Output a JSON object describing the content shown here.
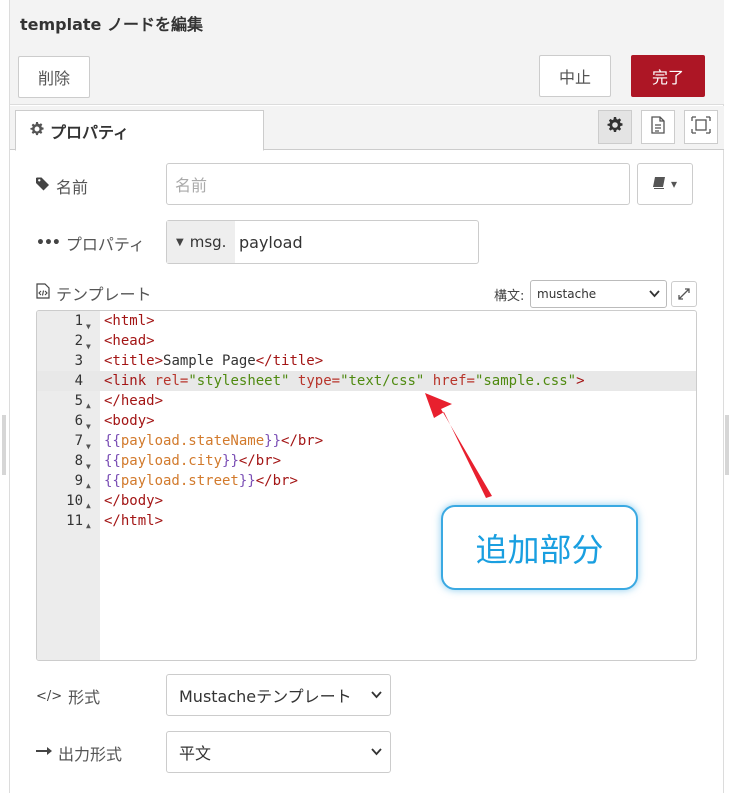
{
  "header": {
    "title": "template ノードを編集",
    "delete_label": "削除",
    "cancel_label": "中止",
    "done_label": "完了"
  },
  "tabs": {
    "properties_label": "プロパティ"
  },
  "form": {
    "name_label": "名前",
    "name_placeholder": "名前",
    "property_label": "プロパティ",
    "property_type": "msg.",
    "property_value": "payload",
    "template_label": "テンプレート",
    "syntax_label": "構文:",
    "syntax_value": "mustache",
    "format_label": "形式",
    "format_value": "Mustacheテンプレート",
    "output_label": "出力形式",
    "output_value": "平文"
  },
  "editor": {
    "line_numbers": [
      "1",
      "2",
      "3",
      "4",
      "5",
      "6",
      "7",
      "8",
      "9",
      "10",
      "11"
    ],
    "highlighted_line": 4
  },
  "callout": {
    "text": "追加部分"
  },
  "colors": {
    "done_button": "#ad1625",
    "callout_border": "#3aa9e2",
    "arrow": "#e8202e"
  }
}
